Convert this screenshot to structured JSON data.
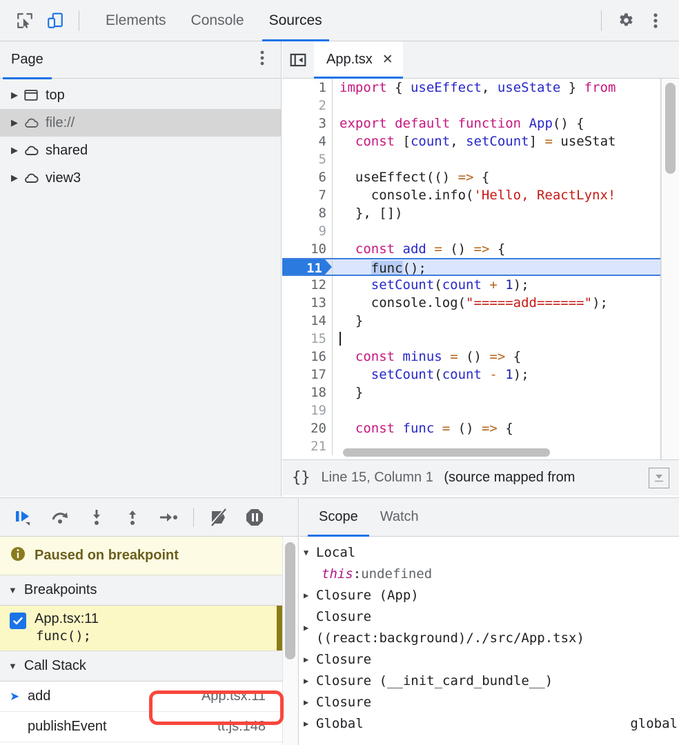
{
  "topbar": {
    "inspect_icon": "inspect-cursor-icon",
    "device_icon": "device-toolbar-icon",
    "tabs": [
      {
        "label": "Elements",
        "active": false
      },
      {
        "label": "Console",
        "active": false
      },
      {
        "label": "Sources",
        "active": true
      }
    ],
    "settings_icon": "gear-icon",
    "more_icon": "more-vertical-icon"
  },
  "navigator": {
    "tab_label": "Page",
    "menu_icon": "more-vertical-icon",
    "tree": [
      {
        "label": "top",
        "icon": "frame-icon",
        "selected": false
      },
      {
        "label": "file://",
        "icon": "cloud-icon",
        "selected": true
      },
      {
        "label": "shared",
        "icon": "cloud-icon",
        "selected": false
      },
      {
        "label": "view3",
        "icon": "cloud-icon",
        "selected": false
      }
    ]
  },
  "editor": {
    "sidebar_toggle_icon": "show-navigator-icon",
    "file_tab": "App.tsx",
    "close_label": "✕",
    "lines": [
      {
        "n": "1",
        "tokens": [
          {
            "t": "import",
            "c": "kw"
          },
          {
            "t": " { ",
            "c": ""
          },
          {
            "t": "useEffect",
            "c": "var"
          },
          {
            "t": ", ",
            "c": ""
          },
          {
            "t": "useState",
            "c": "var"
          },
          {
            "t": " } ",
            "c": ""
          },
          {
            "t": "from",
            "c": "kw"
          }
        ]
      },
      {
        "n": "2",
        "tokens": []
      },
      {
        "n": "3",
        "tokens": [
          {
            "t": "export default function",
            "c": "kw"
          },
          {
            "t": " ",
            "c": ""
          },
          {
            "t": "App",
            "c": "var"
          },
          {
            "t": "() {",
            "c": ""
          }
        ]
      },
      {
        "n": "4",
        "tokens": [
          {
            "t": "  ",
            "c": ""
          },
          {
            "t": "const",
            "c": "kw"
          },
          {
            "t": " [",
            "c": ""
          },
          {
            "t": "count",
            "c": "var"
          },
          {
            "t": ", ",
            "c": ""
          },
          {
            "t": "setCount",
            "c": "var"
          },
          {
            "t": "] ",
            "c": ""
          },
          {
            "t": "=",
            "c": "op"
          },
          {
            "t": " useStat",
            "c": ""
          }
        ]
      },
      {
        "n": "5",
        "tokens": []
      },
      {
        "n": "6",
        "tokens": [
          {
            "t": "  useEffect(() ",
            "c": ""
          },
          {
            "t": "=>",
            "c": "op"
          },
          {
            "t": " {",
            "c": ""
          }
        ]
      },
      {
        "n": "7",
        "tokens": [
          {
            "t": "    console.info(",
            "c": ""
          },
          {
            "t": "'Hello, ReactLynx!",
            "c": "str"
          }
        ]
      },
      {
        "n": "8",
        "tokens": [
          {
            "t": "  }, [])",
            "c": ""
          }
        ]
      },
      {
        "n": "9",
        "tokens": []
      },
      {
        "n": "10",
        "tokens": [
          {
            "t": "  ",
            "c": ""
          },
          {
            "t": "const",
            "c": "kw"
          },
          {
            "t": " ",
            "c": ""
          },
          {
            "t": "add",
            "c": "var"
          },
          {
            "t": " ",
            "c": ""
          },
          {
            "t": "=",
            "c": "op"
          },
          {
            "t": " () ",
            "c": ""
          },
          {
            "t": "=>",
            "c": "op"
          },
          {
            "t": " {",
            "c": ""
          }
        ]
      },
      {
        "n": "11",
        "current": true,
        "tokens": [
          {
            "t": "    ",
            "c": ""
          },
          {
            "t": "func",
            "c": "tok-hl"
          },
          {
            "t": "();",
            "c": ""
          }
        ]
      },
      {
        "n": "12",
        "tokens": [
          {
            "t": "    ",
            "c": ""
          },
          {
            "t": "setCount",
            "c": "var"
          },
          {
            "t": "(",
            "c": ""
          },
          {
            "t": "count",
            "c": "var"
          },
          {
            "t": " ",
            "c": ""
          },
          {
            "t": "+",
            "c": "op"
          },
          {
            "t": " ",
            "c": ""
          },
          {
            "t": "1",
            "c": "num"
          },
          {
            "t": ");",
            "c": ""
          }
        ]
      },
      {
        "n": "13",
        "tokens": [
          {
            "t": "    console.log(",
            "c": ""
          },
          {
            "t": "\"=====add======\"",
            "c": "str"
          },
          {
            "t": ");",
            "c": ""
          }
        ]
      },
      {
        "n": "14",
        "tokens": [
          {
            "t": "  }",
            "c": ""
          }
        ]
      },
      {
        "n": "15",
        "caret": true,
        "tokens": []
      },
      {
        "n": "16",
        "tokens": [
          {
            "t": "  ",
            "c": ""
          },
          {
            "t": "const",
            "c": "kw"
          },
          {
            "t": " ",
            "c": ""
          },
          {
            "t": "minus",
            "c": "var"
          },
          {
            "t": " ",
            "c": ""
          },
          {
            "t": "=",
            "c": "op"
          },
          {
            "t": " () ",
            "c": ""
          },
          {
            "t": "=>",
            "c": "op"
          },
          {
            "t": " {",
            "c": ""
          }
        ]
      },
      {
        "n": "17",
        "tokens": [
          {
            "t": "    ",
            "c": ""
          },
          {
            "t": "setCount",
            "c": "var"
          },
          {
            "t": "(",
            "c": ""
          },
          {
            "t": "count",
            "c": "var"
          },
          {
            "t": " ",
            "c": ""
          },
          {
            "t": "-",
            "c": "op"
          },
          {
            "t": " ",
            "c": ""
          },
          {
            "t": "1",
            "c": "num"
          },
          {
            "t": ");",
            "c": ""
          }
        ]
      },
      {
        "n": "18",
        "tokens": [
          {
            "t": "  }",
            "c": ""
          }
        ]
      },
      {
        "n": "19",
        "tokens": []
      },
      {
        "n": "20",
        "tokens": [
          {
            "t": "  ",
            "c": ""
          },
          {
            "t": "const",
            "c": "kw"
          },
          {
            "t": " ",
            "c": ""
          },
          {
            "t": "func",
            "c": "var"
          },
          {
            "t": " ",
            "c": ""
          },
          {
            "t": "=",
            "c": "op"
          },
          {
            "t": " () ",
            "c": ""
          },
          {
            "t": "=>",
            "c": "op"
          },
          {
            "t": " {",
            "c": ""
          }
        ]
      },
      {
        "n": "21",
        "tokens": []
      }
    ],
    "status": {
      "pretty_print_icon": "{}",
      "position": "Line 15, Column 1",
      "source_note": "(source mapped from",
      "more_icon": "show-more-icon"
    }
  },
  "debugger": {
    "controls": [
      {
        "name": "resume-button",
        "icon": "resume-icon"
      },
      {
        "name": "step-over-button",
        "icon": "step-over-icon"
      },
      {
        "name": "step-into-button",
        "icon": "step-into-icon"
      },
      {
        "name": "step-out-button",
        "icon": "step-out-icon"
      },
      {
        "name": "step-button",
        "icon": "step-icon"
      },
      {
        "name": "deactivate-breakpoints-button",
        "icon": "deactivate-breakpoints-icon"
      },
      {
        "name": "pause-on-exceptions-button",
        "icon": "pause-on-exceptions-icon"
      }
    ],
    "paused_message": "Paused on breakpoint",
    "paused_icon": "info-icon",
    "breakpoints": {
      "title": "Breakpoints",
      "items": [
        {
          "checked": true,
          "location": "App.tsx:11",
          "snippet": "func();"
        }
      ]
    },
    "call_stack": {
      "title": "Call Stack",
      "frames": [
        {
          "name": "add",
          "location": "App.tsx:11",
          "active": true,
          "highlighted": true
        },
        {
          "name": "publishEvent",
          "location": "tt.js:148",
          "active": false,
          "highlighted": false
        }
      ]
    },
    "annotation_color": "#f9463c"
  },
  "scope": {
    "tabs": [
      {
        "label": "Scope",
        "active": true
      },
      {
        "label": "Watch",
        "active": false
      }
    ],
    "rows": [
      {
        "kind": "group",
        "tri": "▼",
        "label": "Local"
      },
      {
        "kind": "this",
        "name": "this",
        "sep": ": ",
        "value": "undefined"
      },
      {
        "kind": "group",
        "tri": "▶",
        "label": "Closure (App)"
      },
      {
        "kind": "group-wrap",
        "tri": "▶",
        "label": "Closure\n((react:background)/./src/App.tsx)"
      },
      {
        "kind": "group",
        "tri": "▶",
        "label": "Closure"
      },
      {
        "kind": "group",
        "tri": "▶",
        "label": "Closure (__init_card_bundle__)"
      },
      {
        "kind": "group",
        "tri": "▶",
        "label": "Closure"
      },
      {
        "kind": "group",
        "tri": "▶",
        "label": "Global",
        "right": "global"
      }
    ]
  },
  "colors": {
    "accent": "#1a73e8",
    "toolbar_bg": "#f1f3f4",
    "breakpoint_row": "#fbf8c5",
    "paused_banner": "#fdfbe4",
    "annotation": "#f9463c",
    "current_line": "#dbe6fd"
  }
}
